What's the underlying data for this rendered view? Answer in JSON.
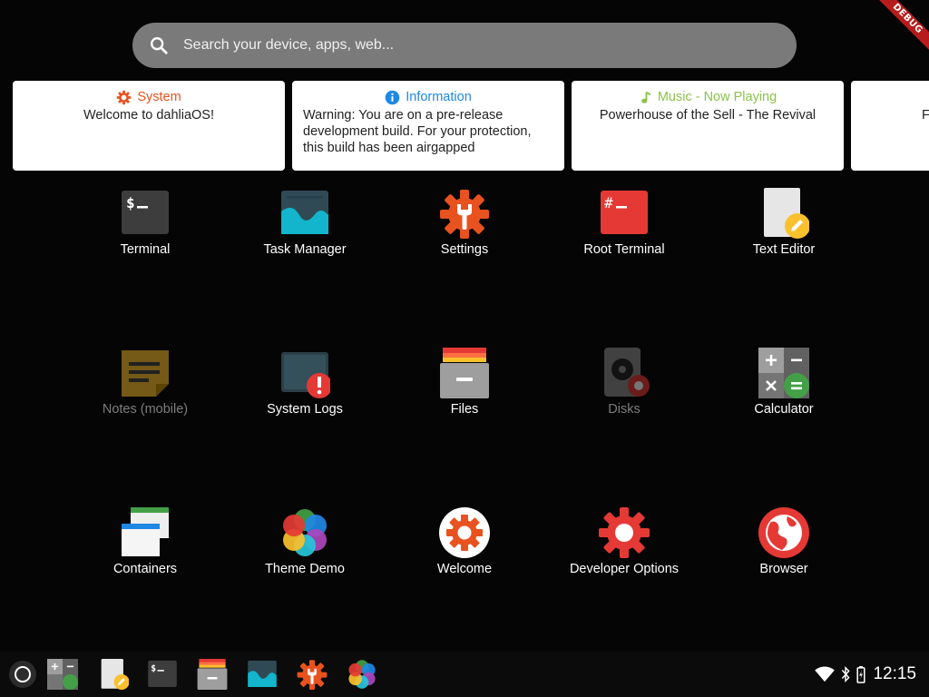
{
  "debug_badge": "DEBUG",
  "search": {
    "placeholder": "Search your device, apps, web..."
  },
  "cards": [
    {
      "title": "System",
      "body": "Welcome to dahliaOS!",
      "title_color": "#e8521f",
      "icon": "gear-icon"
    },
    {
      "title": "Information",
      "body": "Warning: You are on a pre-release development build. For your protection, this build has been airgapped",
      "title_color": "#1e88e5",
      "icon": "info-icon"
    },
    {
      "title": "Music - Now Playing",
      "body": "Powerhouse of the Sell - The Revival",
      "title_color": "#8bc34a",
      "icon": "music-note-icon"
    },
    {
      "title": "",
      "body": "F",
      "title_color": "#222222",
      "icon": ""
    }
  ],
  "apps": [
    {
      "label": "Terminal",
      "icon": "terminal-icon"
    },
    {
      "label": "Task Manager",
      "icon": "task-manager-icon"
    },
    {
      "label": "Settings",
      "icon": "settings-icon"
    },
    {
      "label": "Root Terminal",
      "icon": "root-terminal-icon"
    },
    {
      "label": "Text Editor",
      "icon": "text-editor-icon"
    },
    {
      "label": "Notes (mobile)",
      "icon": "notes-icon",
      "disabled": true
    },
    {
      "label": "System Logs",
      "icon": "system-logs-icon"
    },
    {
      "label": "Files",
      "icon": "files-icon"
    },
    {
      "label": "Disks",
      "icon": "disks-icon",
      "disabled": true
    },
    {
      "label": "Calculator",
      "icon": "calculator-icon"
    },
    {
      "label": "Containers",
      "icon": "containers-icon"
    },
    {
      "label": "Theme Demo",
      "icon": "theme-demo-icon"
    },
    {
      "label": "Welcome",
      "icon": "welcome-icon"
    },
    {
      "label": "Developer Options",
      "icon": "developer-options-icon"
    },
    {
      "label": "Browser",
      "icon": "browser-icon"
    }
  ],
  "taskbar": {
    "launcher_icon": "launcher-circle-icon",
    "pinned": [
      "calculator-icon",
      "text-editor-icon",
      "terminal-icon",
      "files-icon",
      "task-manager-icon",
      "settings-icon",
      "theme-demo-icon"
    ],
    "clock": "12:15",
    "tray_icons": [
      "wifi-icon",
      "bluetooth-icon",
      "battery-icon"
    ]
  }
}
